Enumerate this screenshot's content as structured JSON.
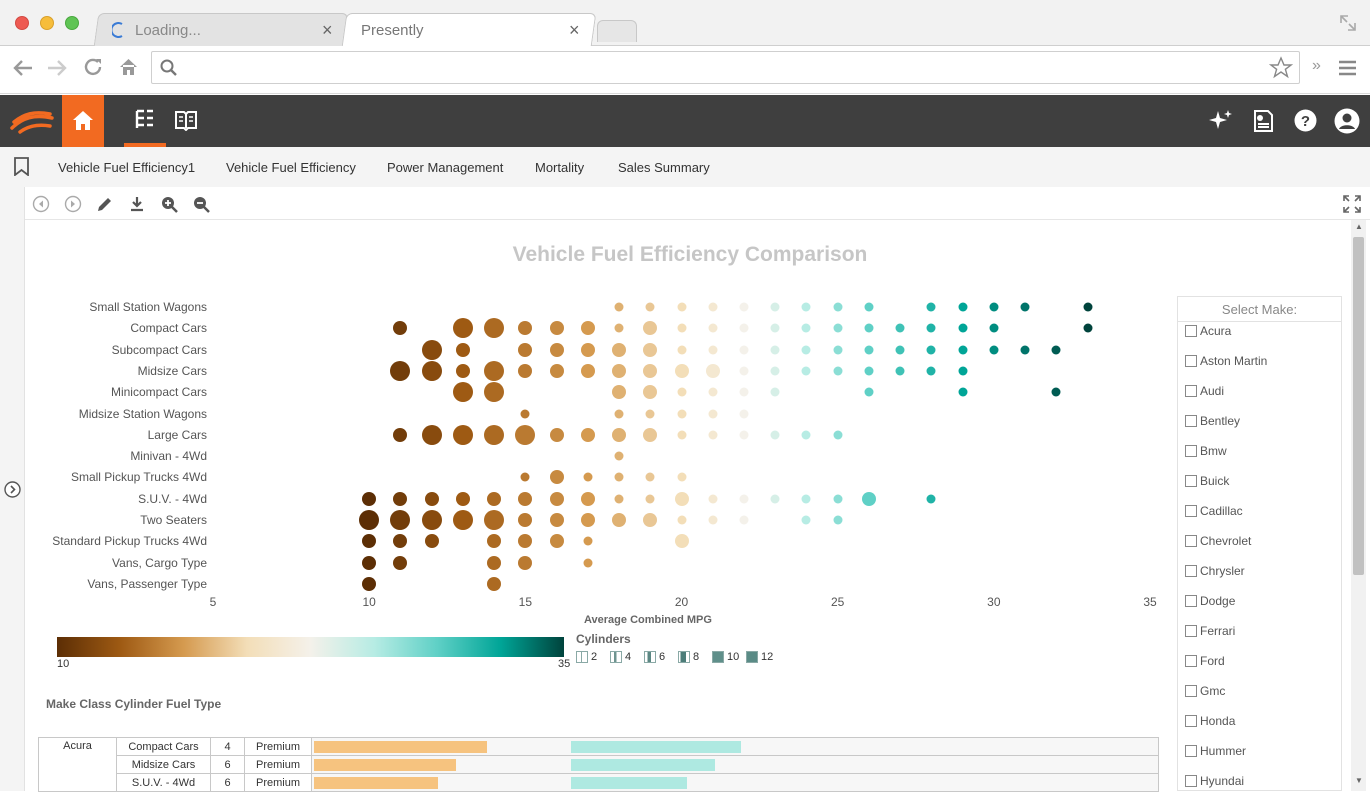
{
  "browser": {
    "tabs": [
      {
        "label": "Loading..."
      },
      {
        "label": "Presently"
      }
    ],
    "address": ""
  },
  "dashboard_tabs": [
    "Vehicle Fuel Efficiency1",
    "Vehicle Fuel Efficiency",
    "Power Management",
    "Mortality",
    "Sales Summary"
  ],
  "icons": {
    "back": "arrow-left-icon",
    "forward": "arrow-right-icon",
    "reload": "reload-icon",
    "home": "home-icon",
    "search": "search-icon",
    "star": "star-icon",
    "more": "chevron-double-right-icon",
    "menu": "hamburger-icon",
    "logo": "brand-logo-icon",
    "app_home": "home-icon",
    "tree": "tree-icon",
    "book": "book-icon",
    "sparkle": "sparkle-icon",
    "report": "report-icon",
    "help": "help-icon",
    "user": "user-icon",
    "bookmark": "bookmark-icon",
    "prev": "prev-circle-icon",
    "next": "next-circle-icon",
    "edit": "pencil-icon",
    "download": "download-icon",
    "zoom_in": "zoom-in-icon",
    "zoom_out": "zoom-out-icon",
    "fullscreen": "fullscreen-icon"
  },
  "colors": {
    "accent": "#f26a21",
    "appbar": "#3f3f3f"
  },
  "chart": {
    "title": "Vehicle Fuel Efficiency Comparison",
    "xlabel": "Average Combined MPG",
    "legend_title": "Cylinders",
    "legend_items": [
      "2",
      "4",
      "6",
      "8",
      "10",
      "12"
    ],
    "color_scale_min": "10",
    "color_scale_max": "35"
  },
  "chart_data": {
    "type": "scatter",
    "title": "Vehicle Fuel Efficiency Comparison",
    "xlabel": "Average Combined MPG",
    "xlim": [
      5,
      35
    ],
    "xticks": [
      5,
      10,
      15,
      20,
      25,
      30,
      35
    ],
    "color_range": [
      10,
      35
    ],
    "categories": [
      "Small Station Wagons",
      "Compact Cars",
      "Subcompact Cars",
      "Midsize Cars",
      "Minicompact Cars",
      "Midsize Station Wagons",
      "Large Cars",
      "Minivan - 4Wd",
      "Small Pickup Trucks 4Wd",
      "S.U.V. - 4Wd",
      "Two Seaters",
      "Standard Pickup Trucks 4Wd",
      "Vans, Cargo Type",
      "Vans, Passenger Type"
    ],
    "series": [
      {
        "category": "Small Station Wagons",
        "points": [
          [
            18,
            4
          ],
          [
            19,
            4
          ],
          [
            20,
            4
          ],
          [
            21,
            4
          ],
          [
            22,
            4
          ],
          [
            23,
            4
          ],
          [
            24,
            4
          ],
          [
            25,
            4
          ],
          [
            26,
            4
          ],
          [
            28,
            4
          ],
          [
            29,
            4
          ],
          [
            30,
            4
          ],
          [
            31,
            4
          ],
          [
            33,
            4
          ]
        ]
      },
      {
        "category": "Compact Cars",
        "points": [
          [
            11,
            6
          ],
          [
            13,
            8
          ],
          [
            14,
            8
          ],
          [
            15,
            6
          ],
          [
            16,
            6
          ],
          [
            17,
            6
          ],
          [
            18,
            4
          ],
          [
            19,
            6
          ],
          [
            20,
            4
          ],
          [
            21,
            4
          ],
          [
            22,
            4
          ],
          [
            23,
            4
          ],
          [
            24,
            4
          ],
          [
            25,
            4
          ],
          [
            26,
            4
          ],
          [
            27,
            4
          ],
          [
            28,
            4
          ],
          [
            29,
            4
          ],
          [
            30,
            4
          ],
          [
            33,
            4
          ]
        ]
      },
      {
        "category": "Subcompact Cars",
        "points": [
          [
            12,
            8
          ],
          [
            13,
            6
          ],
          [
            15,
            6
          ],
          [
            16,
            6
          ],
          [
            17,
            6
          ],
          [
            18,
            6
          ],
          [
            19,
            6
          ],
          [
            20,
            4
          ],
          [
            21,
            4
          ],
          [
            22,
            4
          ],
          [
            23,
            4
          ],
          [
            24,
            4
          ],
          [
            25,
            4
          ],
          [
            26,
            4
          ],
          [
            27,
            4
          ],
          [
            28,
            4
          ],
          [
            29,
            4
          ],
          [
            30,
            4
          ],
          [
            31,
            4
          ],
          [
            32,
            4
          ]
        ]
      },
      {
        "category": "Midsize Cars",
        "points": [
          [
            11,
            8
          ],
          [
            12,
            8
          ],
          [
            13,
            6
          ],
          [
            14,
            8
          ],
          [
            15,
            6
          ],
          [
            16,
            6
          ],
          [
            17,
            6
          ],
          [
            18,
            6
          ],
          [
            19,
            6
          ],
          [
            20,
            6
          ],
          [
            21,
            6
          ],
          [
            22,
            4
          ],
          [
            23,
            4
          ],
          [
            24,
            4
          ],
          [
            25,
            4
          ],
          [
            26,
            4
          ],
          [
            27,
            4
          ],
          [
            28,
            4
          ],
          [
            29,
            4
          ]
        ]
      },
      {
        "category": "Minicompact Cars",
        "points": [
          [
            13,
            8
          ],
          [
            14,
            8
          ],
          [
            18,
            6
          ],
          [
            19,
            6
          ],
          [
            20,
            4
          ],
          [
            21,
            4
          ],
          [
            22,
            4
          ],
          [
            23,
            4
          ],
          [
            26,
            4
          ],
          [
            29,
            4
          ],
          [
            32,
            4
          ]
        ]
      },
      {
        "category": "Midsize Station Wagons",
        "points": [
          [
            15,
            4
          ],
          [
            18,
            4
          ],
          [
            19,
            4
          ],
          [
            20,
            4
          ],
          [
            21,
            4
          ],
          [
            22,
            4
          ]
        ]
      },
      {
        "category": "Large Cars",
        "points": [
          [
            11,
            6
          ],
          [
            12,
            8
          ],
          [
            13,
            8
          ],
          [
            14,
            8
          ],
          [
            15,
            8
          ],
          [
            16,
            6
          ],
          [
            17,
            6
          ],
          [
            18,
            6
          ],
          [
            19,
            6
          ],
          [
            20,
            4
          ],
          [
            21,
            4
          ],
          [
            22,
            4
          ],
          [
            23,
            4
          ],
          [
            24,
            4
          ],
          [
            25,
            4
          ]
        ]
      },
      {
        "category": "Minivan - 4Wd",
        "points": [
          [
            18,
            4
          ]
        ]
      },
      {
        "category": "Small Pickup Trucks 4Wd",
        "points": [
          [
            15,
            4
          ],
          [
            16,
            6
          ],
          [
            17,
            4
          ],
          [
            18,
            4
          ],
          [
            19,
            4
          ],
          [
            20,
            4
          ]
        ]
      },
      {
        "category": "S.U.V. - 4Wd",
        "points": [
          [
            10,
            6
          ],
          [
            11,
            6
          ],
          [
            12,
            6
          ],
          [
            13,
            6
          ],
          [
            14,
            6
          ],
          [
            15,
            6
          ],
          [
            16,
            6
          ],
          [
            17,
            6
          ],
          [
            18,
            4
          ],
          [
            19,
            4
          ],
          [
            20,
            6
          ],
          [
            21,
            4
          ],
          [
            22,
            4
          ],
          [
            23,
            4
          ],
          [
            24,
            4
          ],
          [
            25,
            4
          ],
          [
            26,
            6
          ],
          [
            28,
            4
          ]
        ]
      },
      {
        "category": "Two Seaters",
        "points": [
          [
            10,
            8
          ],
          [
            11,
            8
          ],
          [
            12,
            8
          ],
          [
            13,
            8
          ],
          [
            14,
            8
          ],
          [
            15,
            6
          ],
          [
            16,
            6
          ],
          [
            17,
            6
          ],
          [
            18,
            6
          ],
          [
            19,
            6
          ],
          [
            20,
            4
          ],
          [
            21,
            4
          ],
          [
            22,
            4
          ],
          [
            24,
            4
          ],
          [
            25,
            4
          ]
        ]
      },
      {
        "category": "Standard Pickup Trucks 4Wd",
        "points": [
          [
            10,
            6
          ],
          [
            11,
            6
          ],
          [
            12,
            6
          ],
          [
            14,
            6
          ],
          [
            15,
            6
          ],
          [
            16,
            6
          ],
          [
            17,
            4
          ],
          [
            20,
            6
          ]
        ]
      },
      {
        "category": "Vans, Cargo Type",
        "points": [
          [
            10,
            6
          ],
          [
            11,
            6
          ],
          [
            14,
            6
          ],
          [
            15,
            6
          ],
          [
            17,
            4
          ]
        ]
      },
      {
        "category": "Vans, Passenger Type",
        "points": [
          [
            10,
            6
          ],
          [
            14,
            6
          ]
        ]
      }
    ]
  },
  "table": {
    "title": "Make Class Cylinder Fuel Type",
    "make": "Acura",
    "rows": [
      {
        "class": "Compact Cars",
        "cyl": "4",
        "fuel": "Premium",
        "bar1": 0.68,
        "bar2": 0.6
      },
      {
        "class": "Midsize Cars",
        "cyl": "6",
        "fuel": "Premium",
        "bar1": 0.56,
        "bar2": 0.51
      },
      {
        "class": "S.U.V. - 4Wd",
        "cyl": "6",
        "fuel": "Premium",
        "bar1": 0.49,
        "bar2": 0.41
      }
    ]
  },
  "filter": {
    "title": "Select Make:",
    "items": [
      "Acura",
      "Aston Martin",
      "Audi",
      "Bentley",
      "Bmw",
      "Buick",
      "Cadillac",
      "Chevrolet",
      "Chrysler",
      "Dodge",
      "Ferrari",
      "Ford",
      "Gmc",
      "Honda",
      "Hummer",
      "Hyundai"
    ]
  }
}
